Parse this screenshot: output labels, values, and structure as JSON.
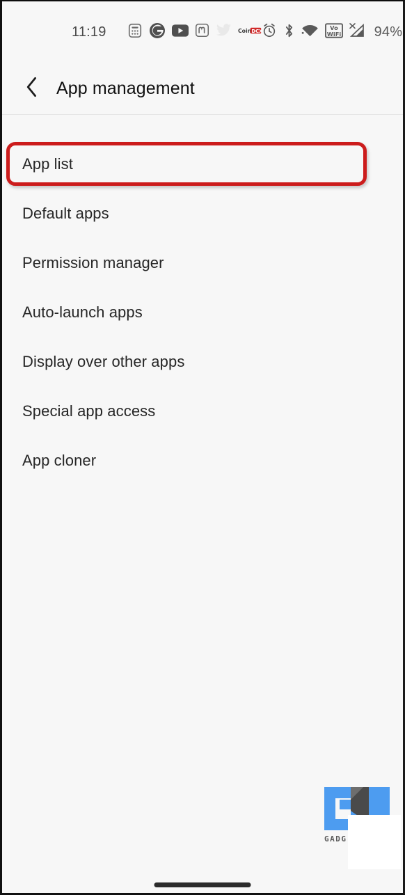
{
  "statusbar": {
    "clock": "11:19",
    "battery_percent": "94%",
    "notification_icons": [
      {
        "name": "calculator-icon",
        "label": "Calculator"
      },
      {
        "name": "google-icon",
        "label": "Google"
      },
      {
        "name": "youtube-icon",
        "label": "YouTube"
      },
      {
        "name": "mastodon-icon",
        "label": "Mastodon"
      },
      {
        "name": "twitter-icon",
        "label": "Twitter"
      },
      {
        "name": "coindcx-icon",
        "label": "CoinDCX"
      }
    ],
    "system_icons": [
      {
        "name": "alarm-icon",
        "label": "Alarm"
      },
      {
        "name": "bluetooth-icon",
        "label": "Bluetooth"
      },
      {
        "name": "wifi-icon",
        "label": "Wi-Fi"
      },
      {
        "name": "vowifi-icon",
        "label": "VoWiFi"
      },
      {
        "name": "cellular-signal-icon",
        "label": "No SIM signal"
      },
      {
        "name": "battery-icon",
        "label": "Battery"
      }
    ]
  },
  "header": {
    "title": "App management",
    "back_icon": "chevron-left-icon"
  },
  "menu": {
    "items": [
      {
        "label": "App list",
        "highlighted": true
      },
      {
        "label": "Default apps",
        "highlighted": false
      },
      {
        "label": "Permission manager",
        "highlighted": false
      },
      {
        "label": "Auto-launch apps",
        "highlighted": false
      },
      {
        "label": "Display over other apps",
        "highlighted": false
      },
      {
        "label": "Special app access",
        "highlighted": false
      },
      {
        "label": "App cloner",
        "highlighted": false
      }
    ]
  },
  "annotation": {
    "highlight_color": "#cc1c1c",
    "target": "App list"
  },
  "watermark": {
    "text": "GADGETSTOUSE",
    "visible_text": "GADG",
    "primary_color": "#4d9cf0",
    "secondary_color": "#4a4a4a"
  },
  "navbar": {
    "home_indicator": "home-indicator"
  },
  "theme": {
    "background": "#f7f7f7",
    "text_primary": "#262626",
    "divider": "#e6e6e6"
  }
}
